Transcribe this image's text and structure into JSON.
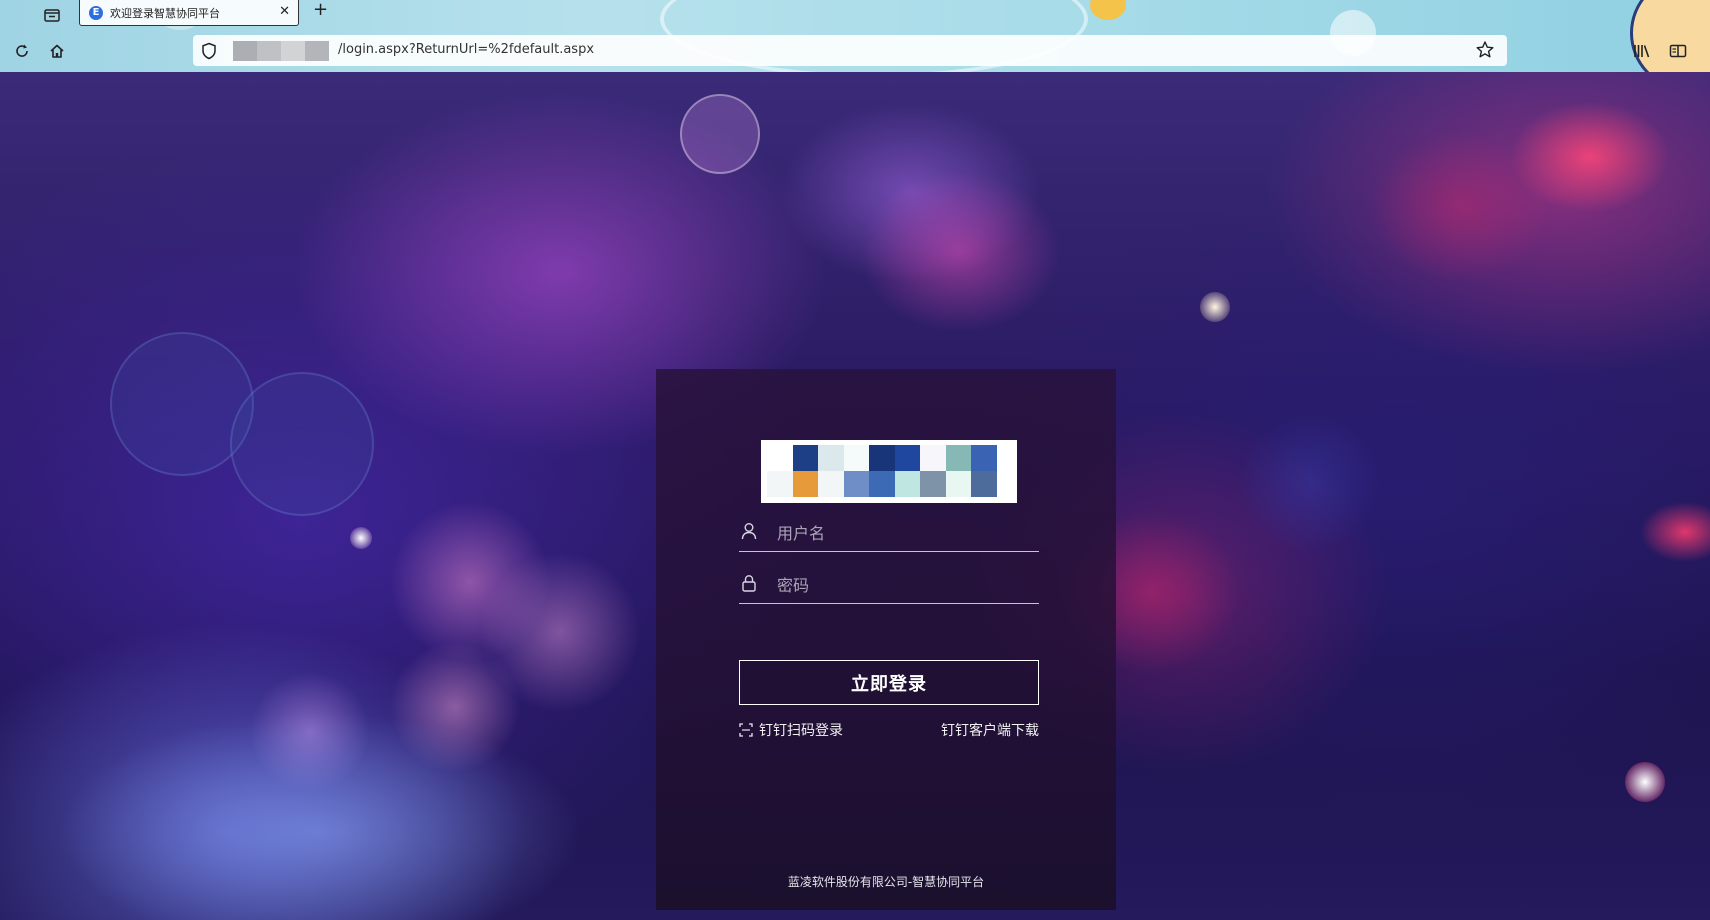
{
  "browser": {
    "tab": {
      "favicon_letter": "E",
      "title": "欢迎登录智慧协同平台"
    },
    "address_bar": {
      "url_path": "/login.aspx?ReturnUrl=%2fdefault.aspx"
    },
    "icons": {
      "tab_list": "tab-list-icon",
      "close_tab": "close-icon",
      "new_tab": "plus-icon",
      "reload": "reload-icon",
      "home": "home-icon",
      "site_info": "shield-icon",
      "bookmark": "star-icon",
      "library": "library-icon",
      "reader_view": "reader-view-icon"
    }
  },
  "login": {
    "username": {
      "placeholder": "用户名",
      "value": ""
    },
    "password": {
      "placeholder": "密码",
      "value": ""
    },
    "submit_label": "立即登录",
    "qr_login_label": "钉钉扫码登录",
    "download_label": "钉钉客户端下载",
    "footer_text": "蓝凌软件股份有限公司-智慧协同平台"
  },
  "colors": {
    "panel_background": "#281238",
    "button_border": "#ffffff",
    "tab_favicon": "#2d6fe0"
  }
}
